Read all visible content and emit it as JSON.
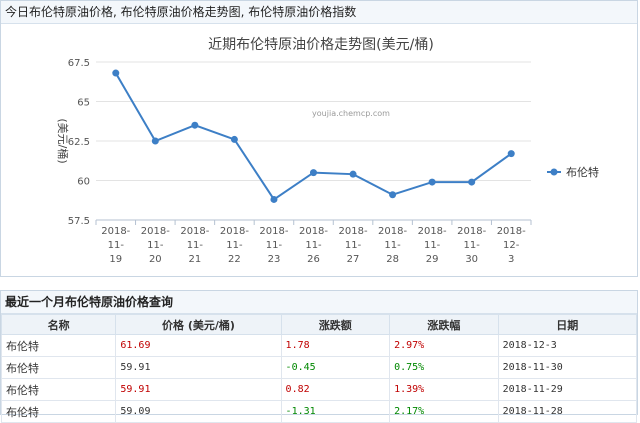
{
  "chart_panel": {
    "header": "今日布伦特原油价格, 布伦特原油价格走势图, 布伦特原油价格指数"
  },
  "chart_data": {
    "type": "line",
    "title": "近期布伦特原油价格走势图(美元/桶)",
    "watermark": "youjia.chemcp.com",
    "ylabel": "(美元/桶)",
    "ylim": [
      57.5,
      67.5
    ],
    "yticks": [
      "57.5",
      "60",
      "62.5",
      "65",
      "67.5"
    ],
    "categories": [
      [
        "2018-",
        "11-",
        "19"
      ],
      [
        "2018-",
        "11-",
        "20"
      ],
      [
        "2018-",
        "11-",
        "21"
      ],
      [
        "2018-",
        "11-",
        "22"
      ],
      [
        "2018-",
        "11-",
        "23"
      ],
      [
        "2018-",
        "11-",
        "26"
      ],
      [
        "2018-",
        "11-",
        "27"
      ],
      [
        "2018-",
        "11-",
        "28"
      ],
      [
        "2018-",
        "11-",
        "29"
      ],
      [
        "2018-",
        "11-",
        "30"
      ],
      [
        "2018-",
        "12-",
        "3"
      ]
    ],
    "series": [
      {
        "name": "布伦特",
        "color": "#3d7fc6",
        "values": [
          66.8,
          62.5,
          63.5,
          62.6,
          58.8,
          60.5,
          60.4,
          59.1,
          59.9,
          59.9,
          61.7
        ]
      }
    ],
    "legend_position": "right"
  },
  "table_panel": {
    "header": "最近一个月布伦特原油价格查询",
    "columns": [
      "名称",
      "价格 (美元/桶)",
      "涨跌额",
      "涨跌幅",
      "日期"
    ],
    "rows": [
      {
        "name": "布伦特",
        "price": "61.69",
        "change": "1.78",
        "pct": "2.97%",
        "date": "2018-12-3",
        "price_color": "red",
        "change_color": "red",
        "pct_color": "red"
      },
      {
        "name": "布伦特",
        "price": "59.91",
        "change": "-0.45",
        "pct": "0.75%",
        "date": "2018-11-30",
        "price_color": "",
        "change_color": "green",
        "pct_color": "green"
      },
      {
        "name": "布伦特",
        "price": "59.91",
        "change": "0.82",
        "pct": "1.39%",
        "date": "2018-11-29",
        "price_color": "red",
        "change_color": "red",
        "pct_color": "red"
      },
      {
        "name": "布伦特",
        "price": "59.09",
        "change": "-1.31",
        "pct": "2.17%",
        "date": "2018-11-28",
        "price_color": "",
        "change_color": "green",
        "pct_color": "green"
      }
    ]
  }
}
